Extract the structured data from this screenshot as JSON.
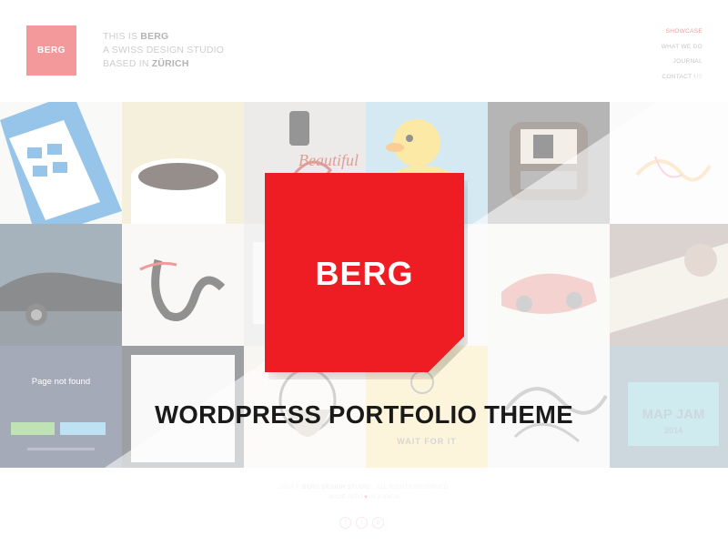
{
  "header": {
    "small_logo": "BERG",
    "tagline_1a": "THIS IS ",
    "tagline_1b": "BERG",
    "tagline_2": "A SWISS DESIGN STUDIO",
    "tagline_3a": "BASED IN ",
    "tagline_3b": "ZÜRICH"
  },
  "nav": {
    "items": [
      "SHOWCASE",
      "WHAT WE DO",
      "JOURNAL",
      "CONTACT US"
    ],
    "active_index": 0
  },
  "grid": {
    "page_not_found": "Page not found",
    "wait_text": "WAIT FOR IT",
    "map_jam": "MAP JAM",
    "map_jam_year": "2014",
    "beautiful": "Beautiful"
  },
  "promo": {
    "logo_text": "BERG",
    "headline": "WORDPRESS PORTFOLIO THEME"
  },
  "footer": {
    "copyright_a": "2014 © ",
    "copyright_b": "BERG DESIGN STUDIO",
    "copyright_c": " · ALL RIGHTS RESERVED",
    "made_a": "MADE WITH ",
    "made_b": " IN ZÜRICH",
    "social": [
      "f",
      "t",
      "d"
    ]
  },
  "colors": {
    "brand_red": "#ee1d23",
    "text_dark": "#1a1a1a"
  }
}
